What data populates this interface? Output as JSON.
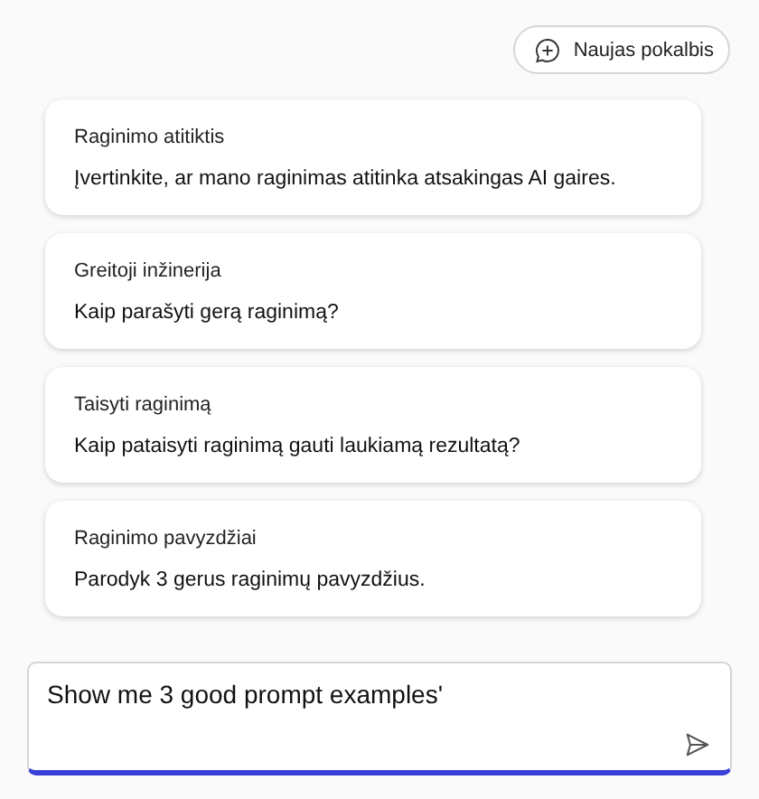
{
  "new_chat_button": {
    "label": "Naujas pokalbis"
  },
  "suggestions": [
    {
      "title": "Raginimo atitiktis",
      "prompt": "Įvertinkite, ar mano raginimas atitinka atsakingas AI gaires."
    },
    {
      "title": "Greitoji inžinerija",
      "prompt": "Kaip parašyti gerą raginimą?"
    },
    {
      "title": "Taisyti raginimą",
      "prompt": "Kaip pataisyti raginimą gauti laukiamą rezultatą?"
    },
    {
      "title": "Raginimo pavyzdžiai",
      "prompt": "Parodyk 3 gerus raginimų pavyzdžius."
    }
  ],
  "composer": {
    "value": "Show me 3 good prompt examples'"
  }
}
